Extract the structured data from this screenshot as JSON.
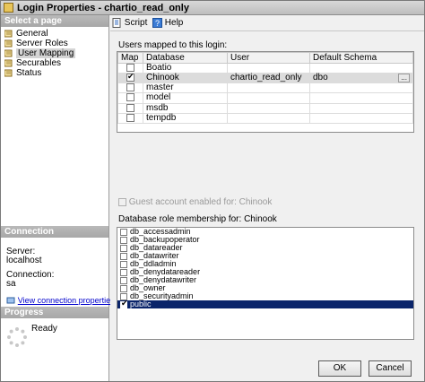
{
  "window": {
    "title": "Login Properties - chartio_read_only"
  },
  "left": {
    "select_page_header": "Select a page",
    "pages": [
      {
        "label": "General",
        "selected": false
      },
      {
        "label": "Server Roles",
        "selected": false
      },
      {
        "label": "User Mapping",
        "selected": true
      },
      {
        "label": "Securables",
        "selected": false
      },
      {
        "label": "Status",
        "selected": false
      }
    ],
    "connection_header": "Connection",
    "server_label": "Server:",
    "server_value": "localhost",
    "connection_label": "Connection:",
    "connection_value": "sa",
    "view_connection_link": "View connection properties",
    "progress_header": "Progress",
    "progress_status": "Ready"
  },
  "toolbar": {
    "script_label": "Script",
    "help_label": "Help"
  },
  "mapping": {
    "title": "Users mapped to this login:",
    "columns": [
      "Map",
      "Database",
      "User",
      "Default Schema"
    ],
    "rows": [
      {
        "map": false,
        "database": "Boatio",
        "user": "",
        "schema": ""
      },
      {
        "map": true,
        "database": "Chinook",
        "user": "chartio_read_only",
        "schema": "dbo",
        "selected": true
      },
      {
        "map": false,
        "database": "master",
        "user": "",
        "schema": ""
      },
      {
        "map": false,
        "database": "model",
        "user": "",
        "schema": ""
      },
      {
        "map": false,
        "database": "msdb",
        "user": "",
        "schema": ""
      },
      {
        "map": false,
        "database": "tempdb",
        "user": "",
        "schema": ""
      }
    ],
    "ellipsis_label": "..."
  },
  "guest": {
    "label": "Guest account enabled for: Chinook"
  },
  "roles": {
    "title": "Database role membership for: Chinook",
    "items": [
      {
        "label": "db_accessadmin",
        "checked": false
      },
      {
        "label": "db_backupoperator",
        "checked": false
      },
      {
        "label": "db_datareader",
        "checked": false
      },
      {
        "label": "db_datawriter",
        "checked": false
      },
      {
        "label": "db_ddladmin",
        "checked": false
      },
      {
        "label": "db_denydatareader",
        "checked": false
      },
      {
        "label": "db_denydatawriter",
        "checked": false
      },
      {
        "label": "db_owner",
        "checked": false
      },
      {
        "label": "db_securityadmin",
        "checked": false
      },
      {
        "label": "public",
        "checked": true,
        "selected": true
      }
    ]
  },
  "buttons": {
    "ok_label": "OK",
    "cancel_label": "Cancel"
  },
  "colors": {
    "selection": "#0a246a",
    "link": "#0000cc",
    "section_header": "#a7a7a7"
  }
}
